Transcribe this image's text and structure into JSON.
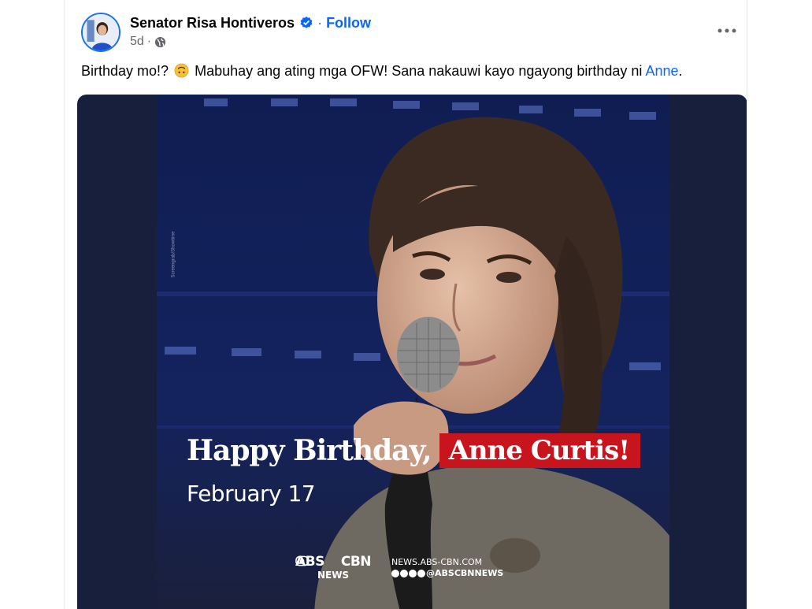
{
  "post": {
    "author": "Senator Risa Hontiveros",
    "separator": "·",
    "follow_label": "Follow",
    "timestamp": "5d",
    "meta_separator": "·",
    "privacy_icon": "globe-icon",
    "more_icon": "more-horizontal-icon",
    "verified_icon": "verified-badge-icon",
    "caption": {
      "before_emoji": "Birthday mo!?",
      "emoji": "upside-down-face-emoji",
      "after_emoji": "Mabuhay ang ating mga OFW! Sana nakauwi kayo ngayong birthday ni",
      "mention": "Anne",
      "end": "."
    }
  },
  "media": {
    "headline": "Happy Birthday,",
    "highlight": "Anne Curtis!",
    "date": "February 17",
    "brand_left": "ABS",
    "brand_right": "CBN",
    "brand_sub": "NEWS",
    "site": "NEWS.ABS-CBN.COM",
    "handle": "@ABSCBNNEWS",
    "watermark": "Screengrab/Showtime"
  },
  "colors": {
    "accent": "#0866ff",
    "highlight_red": "#c8151d",
    "media_bg": "#181f3d"
  }
}
